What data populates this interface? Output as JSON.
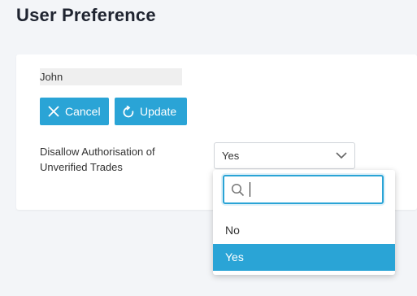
{
  "page": {
    "title": "User Preference"
  },
  "form": {
    "username": "John",
    "cancel_label": "Cancel",
    "update_label": "Update",
    "field_label_line1": "Disallow Authorisation of",
    "field_label_line2": "Unverified Trades",
    "selected_value": "Yes"
  },
  "dropdown": {
    "search_value": "",
    "options": [
      {
        "label": "No",
        "selected": false
      },
      {
        "label": "Yes",
        "selected": true
      }
    ]
  },
  "colors": {
    "accent": "#2aa4d6",
    "background": "#f3f5f8",
    "card": "#ffffff"
  },
  "icons": {
    "cancel": "close-icon",
    "update": "refresh-icon",
    "select": "chevron-down-icon",
    "search": "search-icon"
  }
}
